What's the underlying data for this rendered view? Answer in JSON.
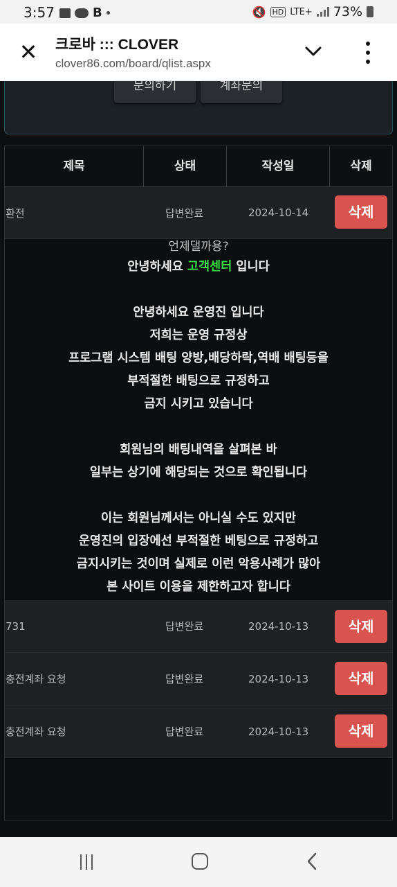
{
  "status_bar": {
    "time": "3:57",
    "network": "LTE+",
    "battery": "73%",
    "hd": "HD"
  },
  "tab": {
    "title": "크로바 ::: CLOVER",
    "url": "clover86.com/board/qlist.aspx",
    "close_icon": "✕"
  },
  "top_buttons": {
    "inquiry": "문의하기",
    "account_inquiry": "계좌문의"
  },
  "table": {
    "headers": [
      "제목",
      "상태",
      "작성일",
      "삭제"
    ],
    "rows": [
      {
        "subject": "환전",
        "status": "답변완료",
        "date": "2024-10-14",
        "delete": "삭제"
      },
      {
        "subject": "731",
        "status": "답변완료",
        "date": "2024-10-13",
        "delete": "삭제"
      },
      {
        "subject": "충전계좌 요청",
        "status": "답변완료",
        "date": "2024-10-13",
        "delete": "삭제"
      },
      {
        "subject": "충전계좌 요청",
        "status": "답변완료",
        "date": "2024-10-13",
        "delete": "삭제"
      }
    ]
  },
  "answer": {
    "question": "언제댈까용?",
    "greeting_prefix": "안녕하세요 ",
    "greeting_highlight": "고객센터",
    "greeting_suffix": " 입니다",
    "lines": [
      "",
      "안녕하세요 운영진 입니다",
      "저희는 운영 규정상",
      "프로그램 시스템 배팅 양방,배당하락,역배 배팅등을",
      "부적절한 배팅으로 규정하고",
      "금지 시키고 있습니다",
      "",
      "회원님의 배팅내역을 살펴본 바",
      "일부는 상기에 해당되는 것으로 확인됩니다",
      "",
      "이는 회원님께서는 아니실 수도 있지만",
      "운영진의 입장에선 부적절한 베팅으로 규정하고",
      "금지시키는 것이며 실제로 이런 악용사례가 많아",
      "본 사이트 이용을 제한하고자 합니다"
    ],
    "highlight_color": "#39e046"
  },
  "colors": {
    "delete_button": "#d9534f",
    "background": "#0d0f10",
    "row_bg": "#1e2124"
  }
}
